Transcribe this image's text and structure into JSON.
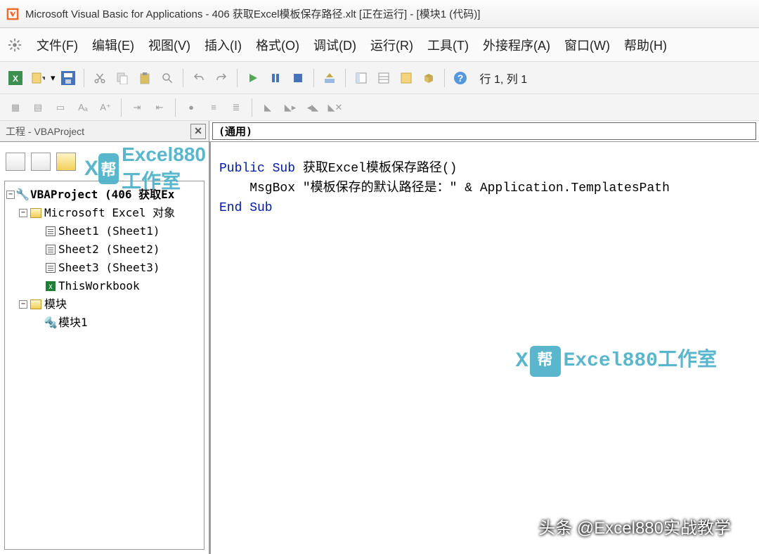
{
  "title": "Microsoft Visual Basic for Applications - 406 获取Excel模板保存路径.xlt [正在运行] - [模块1 (代码)]",
  "menu": {
    "file": "文件(F)",
    "edit": "编辑(E)",
    "view": "视图(V)",
    "insert": "插入(I)",
    "format": "格式(O)",
    "debug": "调试(D)",
    "run": "运行(R)",
    "tools": "工具(T)",
    "addins": "外接程序(A)",
    "window": "窗口(W)",
    "help": "帮助(H)"
  },
  "status": "行 1, 列 1",
  "project_pane_title": "工程 - VBAProject",
  "tree": {
    "root": "VBAProject (406 获取Ex",
    "excel_objs": "Microsoft Excel 对象",
    "sheet1": "Sheet1 (Sheet1)",
    "sheet2": "Sheet2 (Sheet2)",
    "sheet3": "Sheet3 (Sheet3)",
    "thiswb": "ThisWorkbook",
    "modules": "模块",
    "module1": "模块1"
  },
  "object_dropdown": "(通用)",
  "code": {
    "l1a": "Public Sub",
    "l1b": " 获取Excel模板保存路径()",
    "l2": "    MsgBox \"模板保存的默认路径是：\" & Application.TemplatesPath",
    "l3": "End Sub"
  },
  "watermark_text": "Excel880工作室",
  "watermark_badge": "帮",
  "footer": "头条 @Excel880实战教学"
}
